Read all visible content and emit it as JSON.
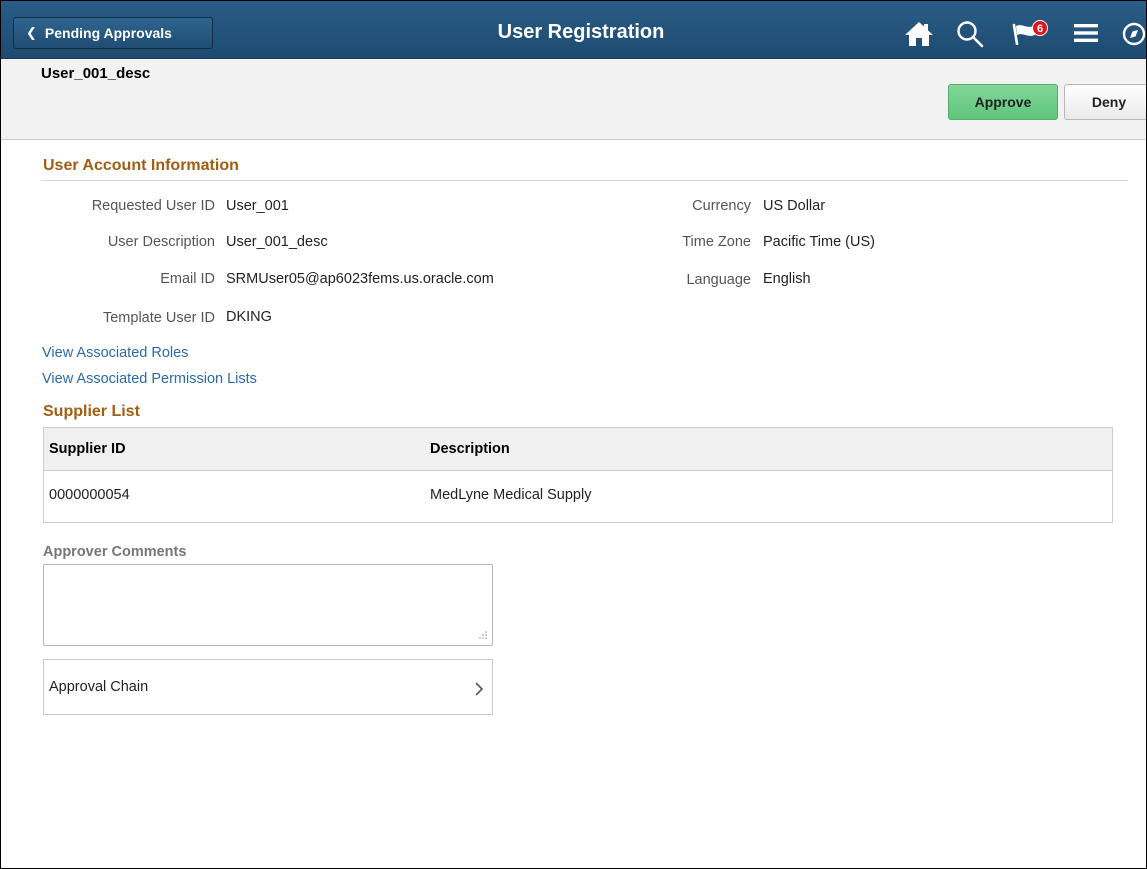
{
  "banner": {
    "back_label": "Pending Approvals",
    "title": "User Registration",
    "notification_count": "6",
    "icons": [
      "home-icon",
      "search-icon",
      "notification-flag-icon",
      "menu-icon",
      "navbar-icon"
    ]
  },
  "header": {
    "description": "User_001_desc",
    "approve_label": "Approve",
    "deny_label": "Deny"
  },
  "account": {
    "section_title": "User Account Information",
    "left_fields": [
      {
        "label": "Requested User ID",
        "value": "User_001"
      },
      {
        "label": "User Description",
        "value": "User_001_desc"
      },
      {
        "label": "Email ID",
        "value": "SRMUser05@ap6023fems.us.oracle.com"
      },
      {
        "label": "Template User ID",
        "value": "DKING"
      }
    ],
    "right_fields": [
      {
        "label": "Currency",
        "value": "US Dollar"
      },
      {
        "label": "Time Zone",
        "value": "Pacific Time (US)"
      },
      {
        "label": "Language",
        "value": "English"
      }
    ]
  },
  "links": {
    "roles": "View Associated Roles",
    "permissions": "View Associated Permission Lists"
  },
  "supplier": {
    "section_title": "Supplier List",
    "columns": [
      "Supplier ID",
      "Description"
    ],
    "rows": [
      {
        "id": "0000000054",
        "description": "MedLyne Medical Supply"
      }
    ]
  },
  "comments": {
    "label": "Approver Comments",
    "value": ""
  },
  "approval_chain": {
    "label": "Approval Chain"
  },
  "colors": {
    "banner": "#1e4a70",
    "section_title": "#a25d13",
    "link": "#2b6ba8",
    "approve": "#5ec57b",
    "badge": "#e3141c"
  }
}
